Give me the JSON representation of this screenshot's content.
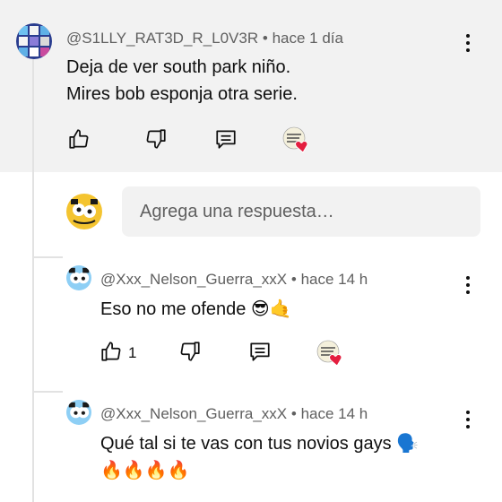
{
  "top_comment": {
    "author": "@S1LLY_RAT3D_R_L0V3R",
    "time": "hace 1 día",
    "lines": [
      "Deja de ver south park niño.",
      "Mires bob esponja otra serie."
    ]
  },
  "reply_input": {
    "placeholder": "Agrega una respuesta…"
  },
  "replies": [
    {
      "author": "@Xxx_Nelson_Guerra_xxX",
      "time": "hace 14 h",
      "lines": [
        "Eso no me ofende 😎🤙"
      ],
      "likes": "1"
    },
    {
      "author": "@Xxx_Nelson_Guerra_xxX",
      "time": "hace 14 h",
      "lines": [
        "Qué tal si te vas con tus novios gays 🗣️",
        "🔥🔥🔥🔥"
      ]
    }
  ],
  "separator": "•",
  "icons": {
    "like": "thumbs-up-icon",
    "dislike": "thumbs-down-icon",
    "reply": "comment-reply-icon",
    "creator_heart": "creator-heart-icon",
    "more": "more-vertical-icon"
  },
  "colors": {
    "highlight_bg": "#f2f2f2",
    "meta_text": "#606060",
    "heart": "#e41e3f"
  }
}
